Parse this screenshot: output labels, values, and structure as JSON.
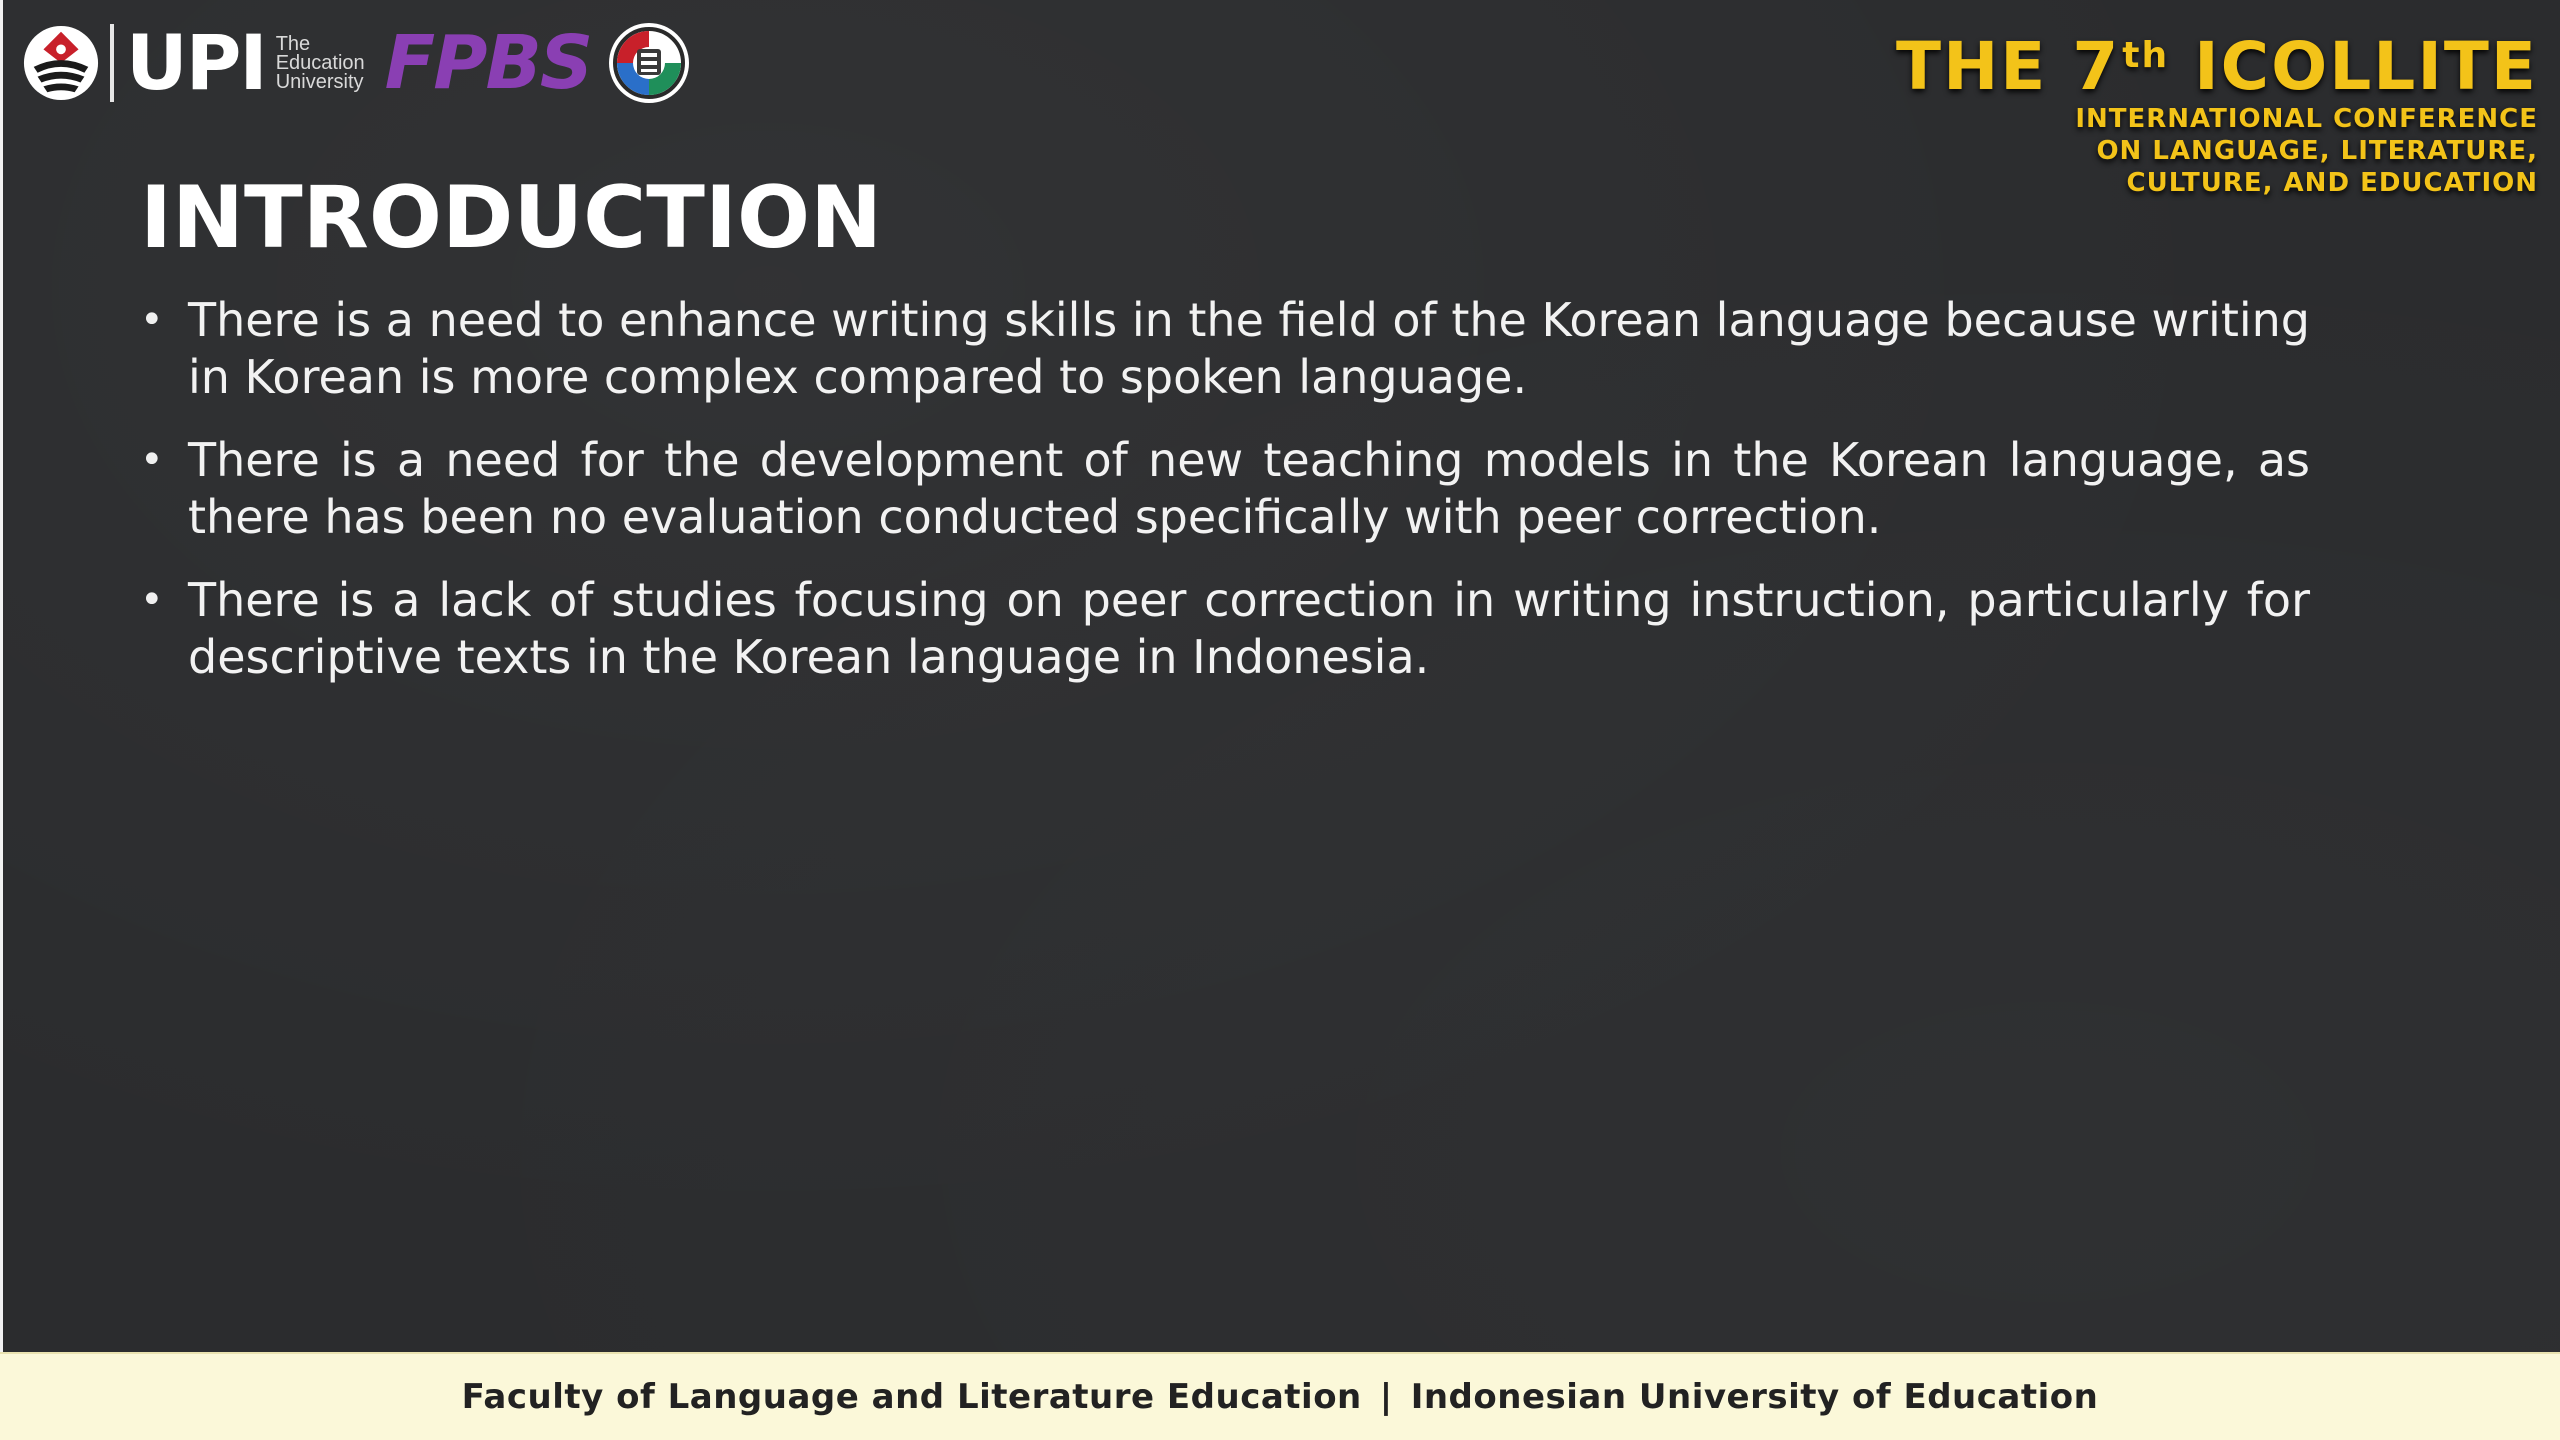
{
  "logos": {
    "upi_wordmark": "UPI",
    "upi_subtext": [
      "The",
      "Education",
      "University"
    ],
    "faculty_mark": "FPBS",
    "upi_emblem_icon": "upi-emblem-icon",
    "seal_icon": "university-seal-icon"
  },
  "conference": {
    "title_prefix": "THE 7",
    "title_ordinal": "th",
    "title_name": "ICOLLITE",
    "subtitle_lines": [
      "INTERNATIONAL CONFERENCE",
      "ON LANGUAGE, LITERATURE,",
      "CULTURE, AND EDUCATION"
    ],
    "accent_color": "#f3c319"
  },
  "slide": {
    "title": "INTRODUCTION",
    "bullets": [
      "There is a need to enhance writing skills in the field of the Korean language because writing in Korean is more complex compared to spoken language.",
      "There is a need for the development of new teaching models in the Korean language, as there has been no evaluation conducted specifically with peer correction.",
      "There is a lack of studies focusing on peer correction in writing instruction, particularly for descriptive texts in the Korean language in Indonesia."
    ],
    "background_color": "#2b2c2e"
  },
  "footer": {
    "left": "Faculty of Language and Literature Education",
    "separator": "|",
    "right": "Indonesian University of Education",
    "background_color": "#fbf8d9"
  }
}
